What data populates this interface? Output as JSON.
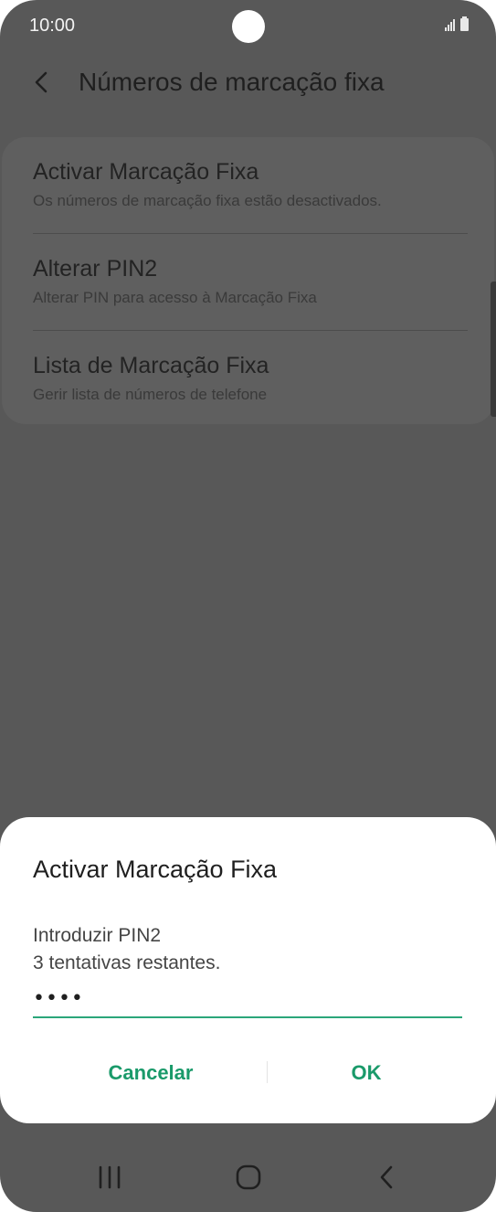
{
  "status_bar": {
    "time": "10:00"
  },
  "header": {
    "title": "Números de marcação fixa"
  },
  "settings": {
    "items": [
      {
        "title": "Activar Marcação Fixa",
        "subtitle": "Os números de marcação fixa estão desactivados."
      },
      {
        "title": "Alterar PIN2",
        "subtitle": "Alterar PIN para acesso à Marcação Fixa"
      },
      {
        "title": "Lista de Marcação Fixa",
        "subtitle": "Gerir lista de números de telefone"
      }
    ]
  },
  "dialog": {
    "title": "Activar Marcação Fixa",
    "message_line1": "Introduzir PIN2",
    "message_line2": "3 tentativas restantes.",
    "pin_value": "••••",
    "cancel_label": "Cancelar",
    "ok_label": "OK"
  },
  "colors": {
    "accent": "#1a9a6a",
    "scrim_background": "#585858",
    "dialog_background": "#ffffff"
  },
  "icons": {
    "back": "chevron-left-icon",
    "nav_recent": "recent-apps-icon",
    "nav_home": "home-icon",
    "nav_back": "back-icon"
  }
}
